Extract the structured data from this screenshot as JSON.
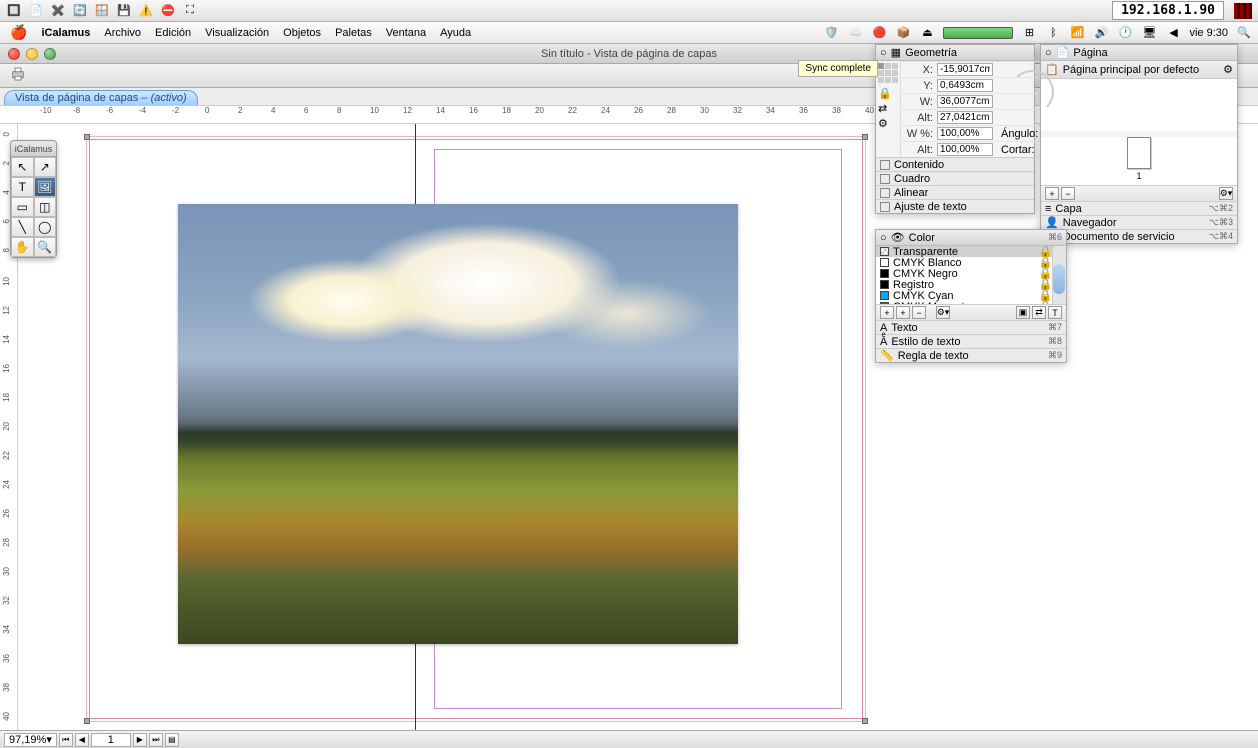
{
  "ip_address": "192.168.1.90",
  "menubar": {
    "app": "iCalamus",
    "items": [
      "Archivo",
      "Edición",
      "Visualización",
      "Objetos",
      "Paletas",
      "Ventana",
      "Ayuda"
    ],
    "clock": "vie 9:30"
  },
  "window_title": "Sin título - Vista de página de capas",
  "sync_tooltip": "Sync complete",
  "tab": {
    "label": "Vista de página de capas – ",
    "state": "(activo)"
  },
  "tool_palette_title": "iCalamus",
  "ruler_h": [
    "-10",
    "-8",
    "-6",
    "-4",
    "-2",
    "0",
    "2",
    "4",
    "6",
    "8",
    "10",
    "12",
    "14",
    "16",
    "18",
    "20",
    "22",
    "24",
    "26",
    "28",
    "30",
    "32",
    "34",
    "36",
    "38",
    "40"
  ],
  "ruler_v": [
    "0",
    "2",
    "4",
    "6",
    "8",
    "10",
    "12",
    "14",
    "16",
    "18",
    "20",
    "22",
    "24",
    "26",
    "28",
    "30",
    "32",
    "34",
    "36",
    "38",
    "40"
  ],
  "geometry": {
    "title": "Geometría",
    "x": "-15,9017cm",
    "y": "0,6493cm",
    "w": "36,0077cm",
    "alt": "27,0421cm",
    "wpct": "100,00%",
    "altpct": "100,00%",
    "angulo": "Ángulo:",
    "cortar": "Cortar:",
    "sections": [
      "Contenido",
      "Cuadro",
      "Alinear",
      "Ajuste de texto"
    ]
  },
  "pagina": {
    "title": "Página",
    "default_label": "Página principal por defecto",
    "thumb_number": "1",
    "menu": [
      {
        "label": "Capa",
        "sc": "⌥⌘2"
      },
      {
        "label": "Navegador",
        "sc": "⌥⌘3"
      },
      {
        "label": "Documento de servicio",
        "sc": "⌥⌘4"
      }
    ]
  },
  "color": {
    "title": "Color",
    "shortcut": "⌘6",
    "items": [
      {
        "name": "Transparente",
        "hex": "transparent"
      },
      {
        "name": "CMYK Blanco",
        "hex": "#ffffff"
      },
      {
        "name": "CMYK Negro",
        "hex": "#000000"
      },
      {
        "name": "Registro",
        "hex": "#000000"
      },
      {
        "name": "CMYK Cyan",
        "hex": "#00aeef"
      },
      {
        "name": "CMYK Magenta",
        "hex": "#ec008c"
      }
    ],
    "text_sections": [
      {
        "label": "Texto",
        "sc": "⌘7"
      },
      {
        "label": "Estilo de texto",
        "sc": "⌘8"
      },
      {
        "label": "Regla de texto",
        "sc": "⌘9"
      }
    ]
  },
  "status": {
    "zoom": "97,19%",
    "page": "1"
  }
}
